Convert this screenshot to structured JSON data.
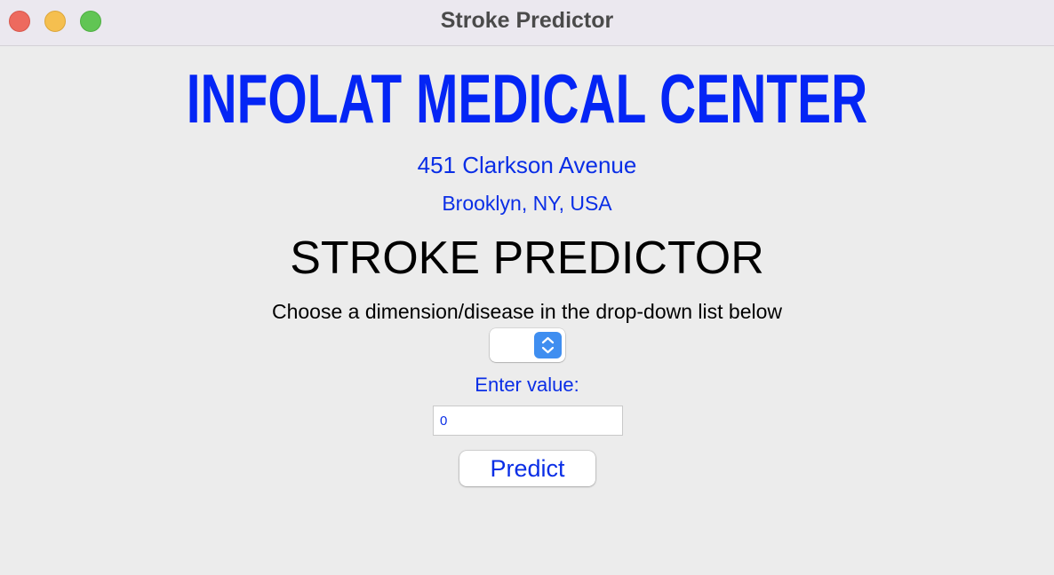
{
  "window": {
    "title": "Stroke Predictor"
  },
  "header": {
    "hospital_name": "INFOLAT MEDICAL CENTER",
    "address_line1": "451 Clarkson Avenue",
    "address_line2": "Brooklyn, NY, USA"
  },
  "main": {
    "heading": "STROKE PREDICTOR",
    "instruction": "Choose a dimension/disease in the drop-down list below",
    "dropdown": {
      "selected_value": "",
      "icon": "chevron-up-down-icon"
    },
    "value_label": "Enter value:",
    "value_input": {
      "value": "0"
    },
    "predict_label": "Predict"
  },
  "colors": {
    "accent_blue": "#0425f5",
    "text_blue": "#0a2ee6",
    "stepper_blue": "#3f8ef0",
    "close": "#ed6a5e",
    "minimize": "#f5bf4f",
    "zoom": "#61c554"
  }
}
